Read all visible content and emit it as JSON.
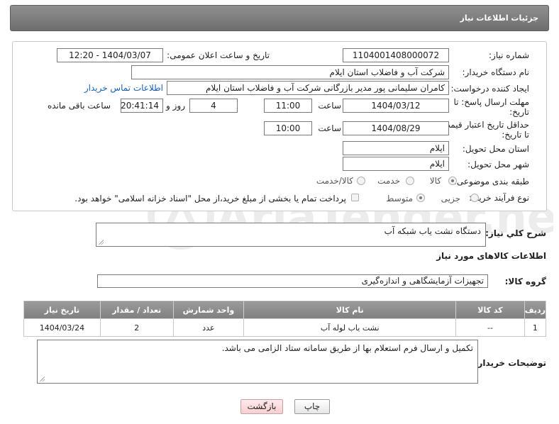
{
  "header": {
    "title": "جزئیات اطلاعات نیاز"
  },
  "form": {
    "need_number_label": "شماره نیاز:",
    "need_number": "1104001408000072",
    "announce_label": "تاریخ و ساعت اعلان عمومی:",
    "announce_value": "1404/03/07 - 12:20",
    "buyer_org_label": "نام دستگاه خریدار:",
    "buyer_org": "شرکت آب و فاضلاب استان ایلام",
    "creator_label": "ایجاد کننده درخواست:",
    "creator": "کامران سلیمانی پور مدیر بازرگانی شرکت آب و فاضلاب استان ایلام",
    "contact_link": "اطلاعات تماس خریدار",
    "deadline_label_1": "مهلت ارسال پاسخ: تا",
    "deadline_label_2": "تاریخ:",
    "deadline_date": "1404/03/12",
    "time_label": "ساعت",
    "deadline_time": "11:00",
    "days_value": "4",
    "days_label": "روز و",
    "remaining_time": "20:41:14",
    "remaining_label": "ساعت باقی مانده",
    "price_validity_label_1": "حداقل تاریخ اعتبار قیمت:",
    "price_validity_label_2": "تا تاریخ:",
    "validity_date": "1404/08/29",
    "validity_time": "10:00",
    "province_label": "استان محل تحویل:",
    "province": "ایلام",
    "city_label": "شهر محل تحویل:",
    "city": "ایلام",
    "category_label": "طبقه بندی موضوعی:",
    "category_options": [
      "کالا",
      "خدمت",
      "کالا/خدمت"
    ],
    "process_label": "نوع فرآیند خرید :",
    "process_options": [
      "جزیی",
      "متوسط"
    ],
    "payment_note": "پرداخت تمام یا بخشی از مبلغ خرید،از محل \"اسناد خزانه اسلامی\" خواهد بود."
  },
  "summary": {
    "label": "شرح كلي نياز:",
    "value": "دستگاه نشت یاب شبکه آب"
  },
  "goods": {
    "section_title": "اطلاعات کالاهای مورد نیاز",
    "group_label": "گروه کالا:",
    "group_value": "تجهیزات آزمایشگاهی و اندازه‌گیری",
    "columns": [
      "ردیف",
      "کد کالا",
      "نام کالا",
      "واحد شمارش",
      "تعداد / مقدار",
      "تاریخ نیاز"
    ],
    "rows": [
      [
        "1",
        "--",
        "نشت یاب لوله آب",
        "عدد",
        "2",
        "1404/03/24"
      ]
    ]
  },
  "notes": {
    "label": "توضیحات خریدار:",
    "value": "تکمیل و ارسال فرم استعلام بها از طریق سامانه ستاد الزامی می باشد."
  },
  "buttons": {
    "print": "چاپ",
    "back": "بازگشت"
  },
  "watermark_text": "AriaTender.net"
}
